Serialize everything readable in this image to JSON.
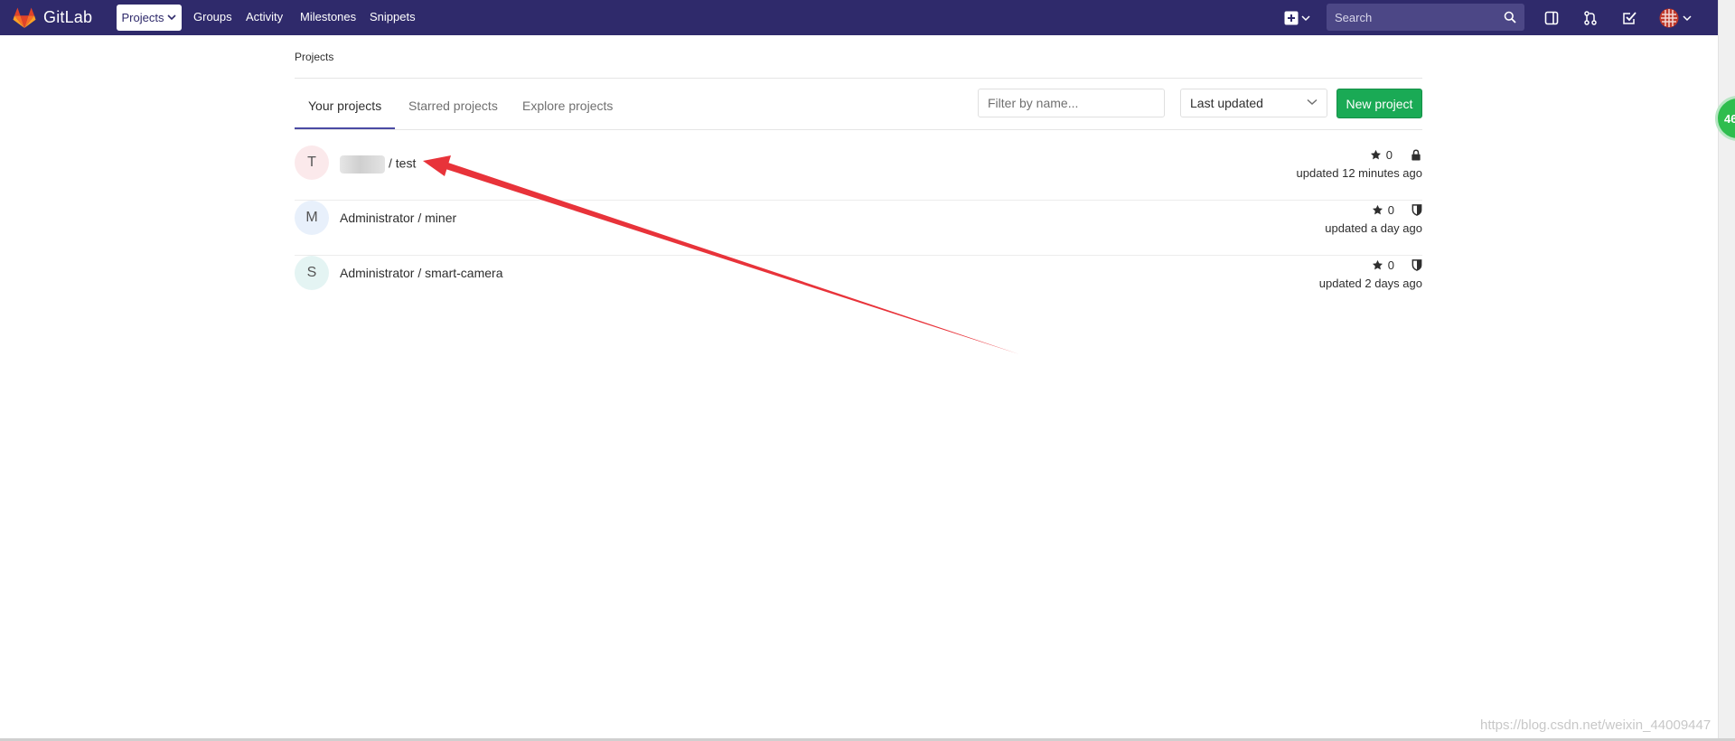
{
  "navbar": {
    "brand": "GitLab",
    "menu": {
      "projects": "Projects",
      "groups": "Groups",
      "activity": "Activity",
      "milestones": "Milestones",
      "snippets": "Snippets"
    },
    "search_placeholder": "Search",
    "colors": {
      "background": "#2f2a6b",
      "search_bg": "#4c4786"
    }
  },
  "breadcrumb": "Projects",
  "tabs": {
    "your": "Your projects",
    "starred": "Starred projects",
    "explore": "Explore projects"
  },
  "filter_placeholder": "Filter by name...",
  "sort_value": "Last updated",
  "new_project_label": "New project",
  "projects": [
    {
      "initial": "T",
      "name": "/ test",
      "stars": "0",
      "updated": "updated 12 minutes ago",
      "visibility": "lock-icon",
      "avatar_color": "#fbe9eb"
    },
    {
      "initial": "M",
      "name": "Administrator / miner",
      "stars": "0",
      "updated": "updated a day ago",
      "visibility": "shield-icon",
      "avatar_color": "#e8f0fb"
    },
    {
      "initial": "S",
      "name": "Administrator / smart-camera",
      "stars": "0",
      "updated": "updated 2 days ago",
      "visibility": "shield-icon",
      "avatar_color": "#e4f4f3"
    }
  ],
  "badge_text": "46",
  "watermark": "https://blog.csdn.net/weixin_44009447",
  "colors": {
    "accent": "#4b4ba3",
    "new_button": "#1aaa55",
    "arrow": "#e8333a"
  }
}
